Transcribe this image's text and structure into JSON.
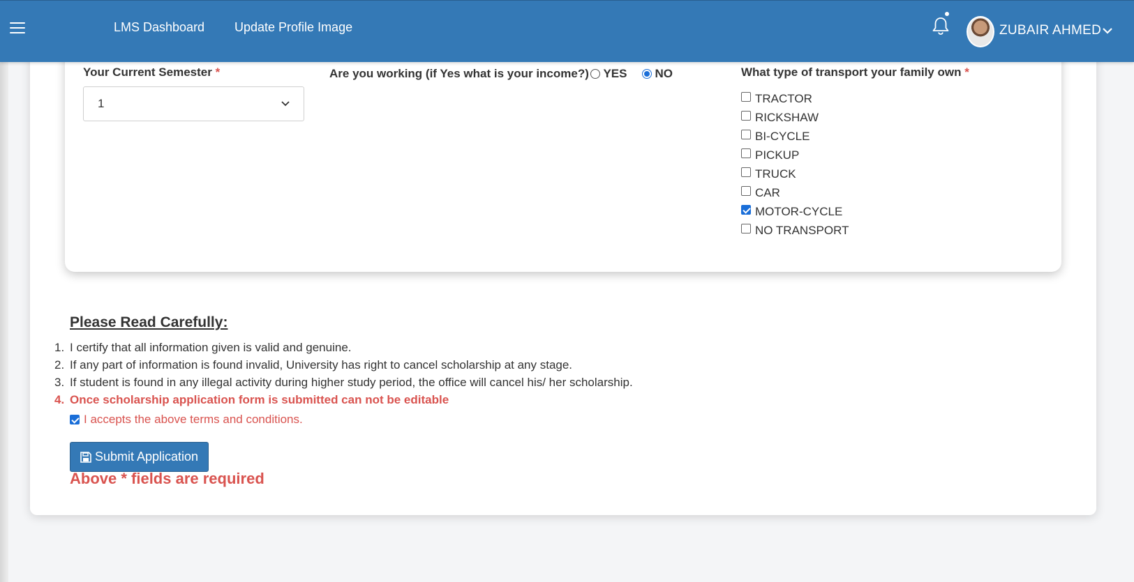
{
  "navbar": {
    "links": [
      "LMS Dashboard",
      "Update Profile Image"
    ],
    "user_name": "ZUBAIR AHMED",
    "icons": [
      "menu-icon",
      "bell-icon",
      "chevron-down-icon"
    ]
  },
  "form": {
    "semester": {
      "label": "Your Current Semester",
      "required_mark": "*",
      "value": "1"
    },
    "working": {
      "label": "Are you working (if Yes what is your income?)",
      "required_mark": "*",
      "options": [
        {
          "label": "YES",
          "checked": false
        },
        {
          "label": "NO",
          "checked": true
        }
      ]
    },
    "transport": {
      "label": "What type of transport your family own",
      "required_mark": "*",
      "options": [
        {
          "label": "TRACTOR",
          "checked": false
        },
        {
          "label": "RICKSHAW",
          "checked": false
        },
        {
          "label": "BI-CYCLE",
          "checked": false
        },
        {
          "label": "PICKUP",
          "checked": false
        },
        {
          "label": "TRUCK",
          "checked": false
        },
        {
          "label": "CAR",
          "checked": false
        },
        {
          "label": "MOTOR-CYCLE",
          "checked": true
        },
        {
          "label": "NO TRANSPORT",
          "checked": false
        }
      ]
    }
  },
  "notice": {
    "title": "Please Read Carefully:",
    "items": [
      {
        "num": "1.",
        "text": "I certify that all information given is valid and genuine."
      },
      {
        "num": "2.",
        "text": "If any part of information is found invalid, University has right to cancel scholarship at any stage."
      },
      {
        "num": "3.",
        "text": "If student is found in any illegal activity during higher study period, the office will cancel his/ her scholarship."
      },
      {
        "num": "4.",
        "text": "Once scholarship application form is submitted can not be editable"
      }
    ],
    "accept_label": "I accepts the above terms and conditions.",
    "accept_checked": true
  },
  "submit_label": "Submit Application",
  "required_note": "Above * fields are required",
  "colors": {
    "brand": "#3479b6",
    "danger": "#d9534f",
    "check": "#1a6ed8"
  }
}
